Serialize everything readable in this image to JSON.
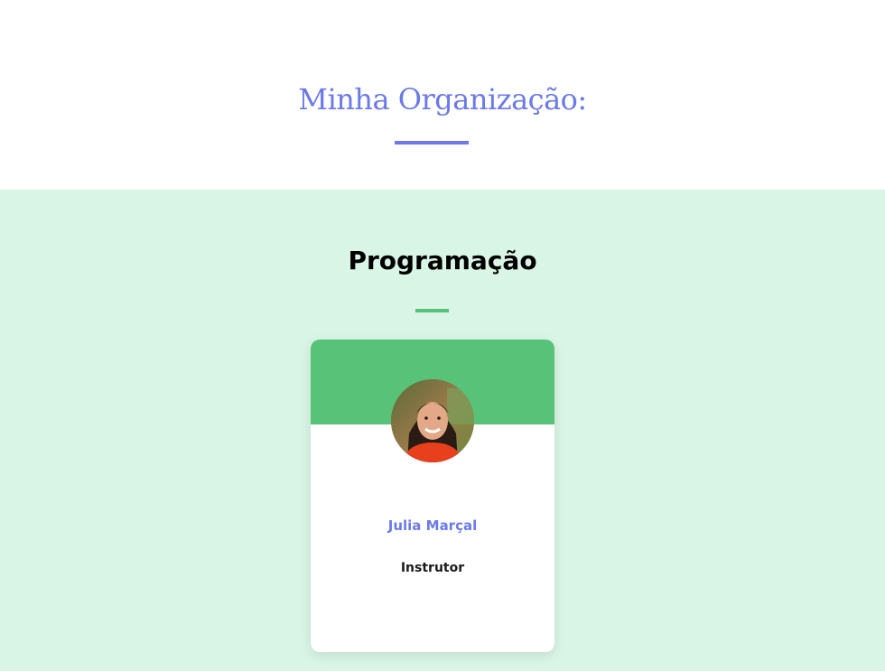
{
  "header": {
    "title": "Minha Organização:"
  },
  "team": {
    "title": "Programação",
    "accent_color": "#57c278",
    "background_color": "#d9f5e6",
    "members": [
      {
        "name": "Julia Marçal",
        "role": "Instrutor",
        "avatar_icon": "user-photo"
      }
    ]
  },
  "colors": {
    "title_color": "#6b7ae8"
  }
}
